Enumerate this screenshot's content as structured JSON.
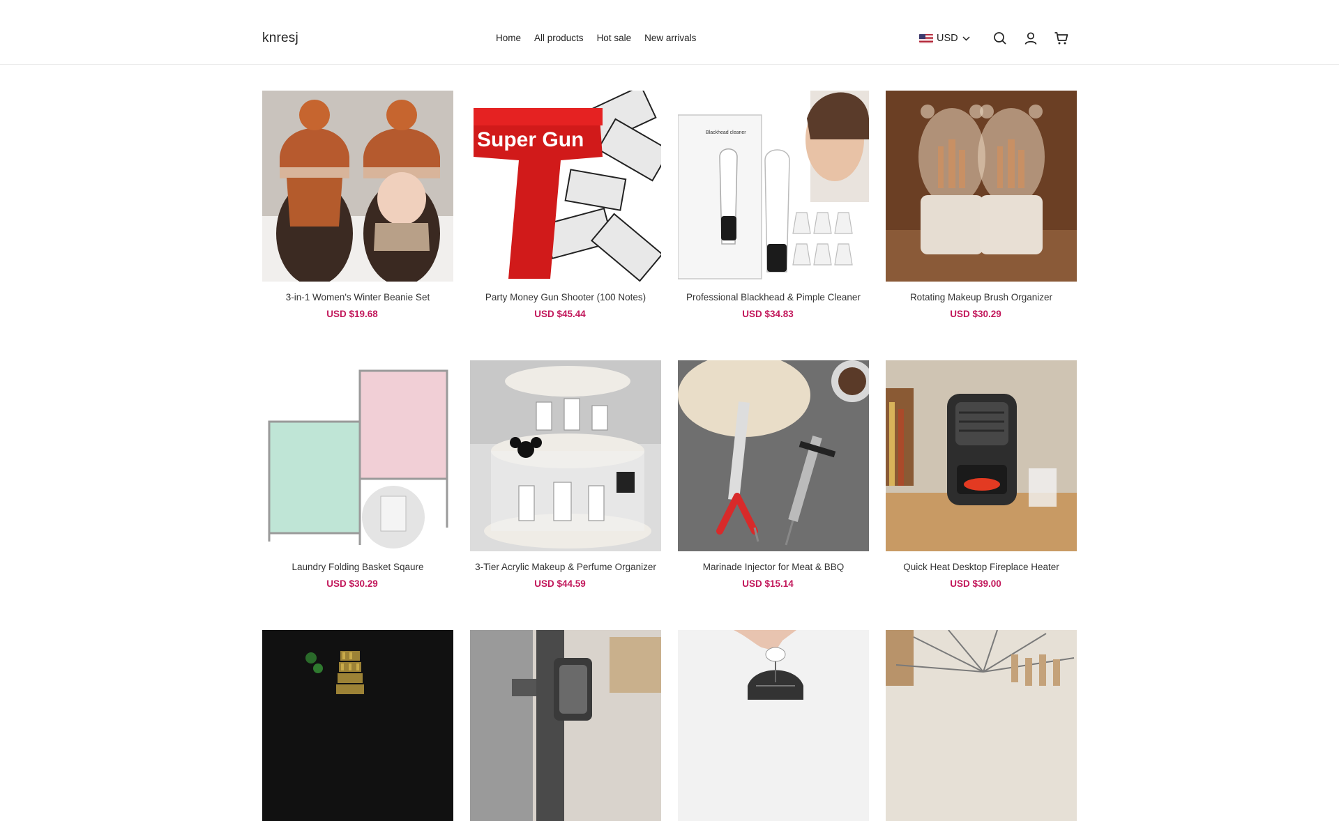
{
  "header": {
    "logo": "knresj",
    "nav": [
      "Home",
      "All products",
      "Hot sale",
      "New arrivals"
    ],
    "currency": "USD",
    "icons": [
      "search-icon",
      "account-icon",
      "cart-icon"
    ]
  },
  "products": [
    {
      "name": "3-in-1 Women's Winter Beanie Set",
      "price": "USD $19.68",
      "image": "beanie-set"
    },
    {
      "name": "Party Money Gun Shooter (100 Notes)",
      "price": "USD $45.44",
      "image": "money-gun",
      "image_text": "Super Gun"
    },
    {
      "name": "Professional Blackhead & Pimple Cleaner",
      "price": "USD $34.83",
      "image": "blackhead-cleaner",
      "image_text": "Blackhead cleaner"
    },
    {
      "name": "Rotating Makeup Brush Organizer",
      "price": "USD $30.29",
      "image": "brush-organizer"
    },
    {
      "name": "Laundry Folding Basket Sqaure",
      "price": "USD $30.29",
      "image": "laundry-basket"
    },
    {
      "name": "3-Tier Acrylic Makeup & Perfume Organizer",
      "price": "USD $44.59",
      "image": "perfume-organizer"
    },
    {
      "name": "Marinade Injector for Meat & BBQ",
      "price": "USD $15.14",
      "image": "marinade-injector"
    },
    {
      "name": "Quick Heat Desktop Fireplace Heater",
      "price": "USD $39.00",
      "image": "desktop-heater"
    },
    {
      "name": "",
      "price": "",
      "image": "tower-figurine"
    },
    {
      "name": "",
      "price": "",
      "image": "door-hook"
    },
    {
      "name": "",
      "price": "",
      "image": "hand-product"
    },
    {
      "name": "",
      "price": "",
      "image": "drying-rack"
    }
  ],
  "colors": {
    "accent_price": "#c2185b",
    "border": "#ececec"
  }
}
